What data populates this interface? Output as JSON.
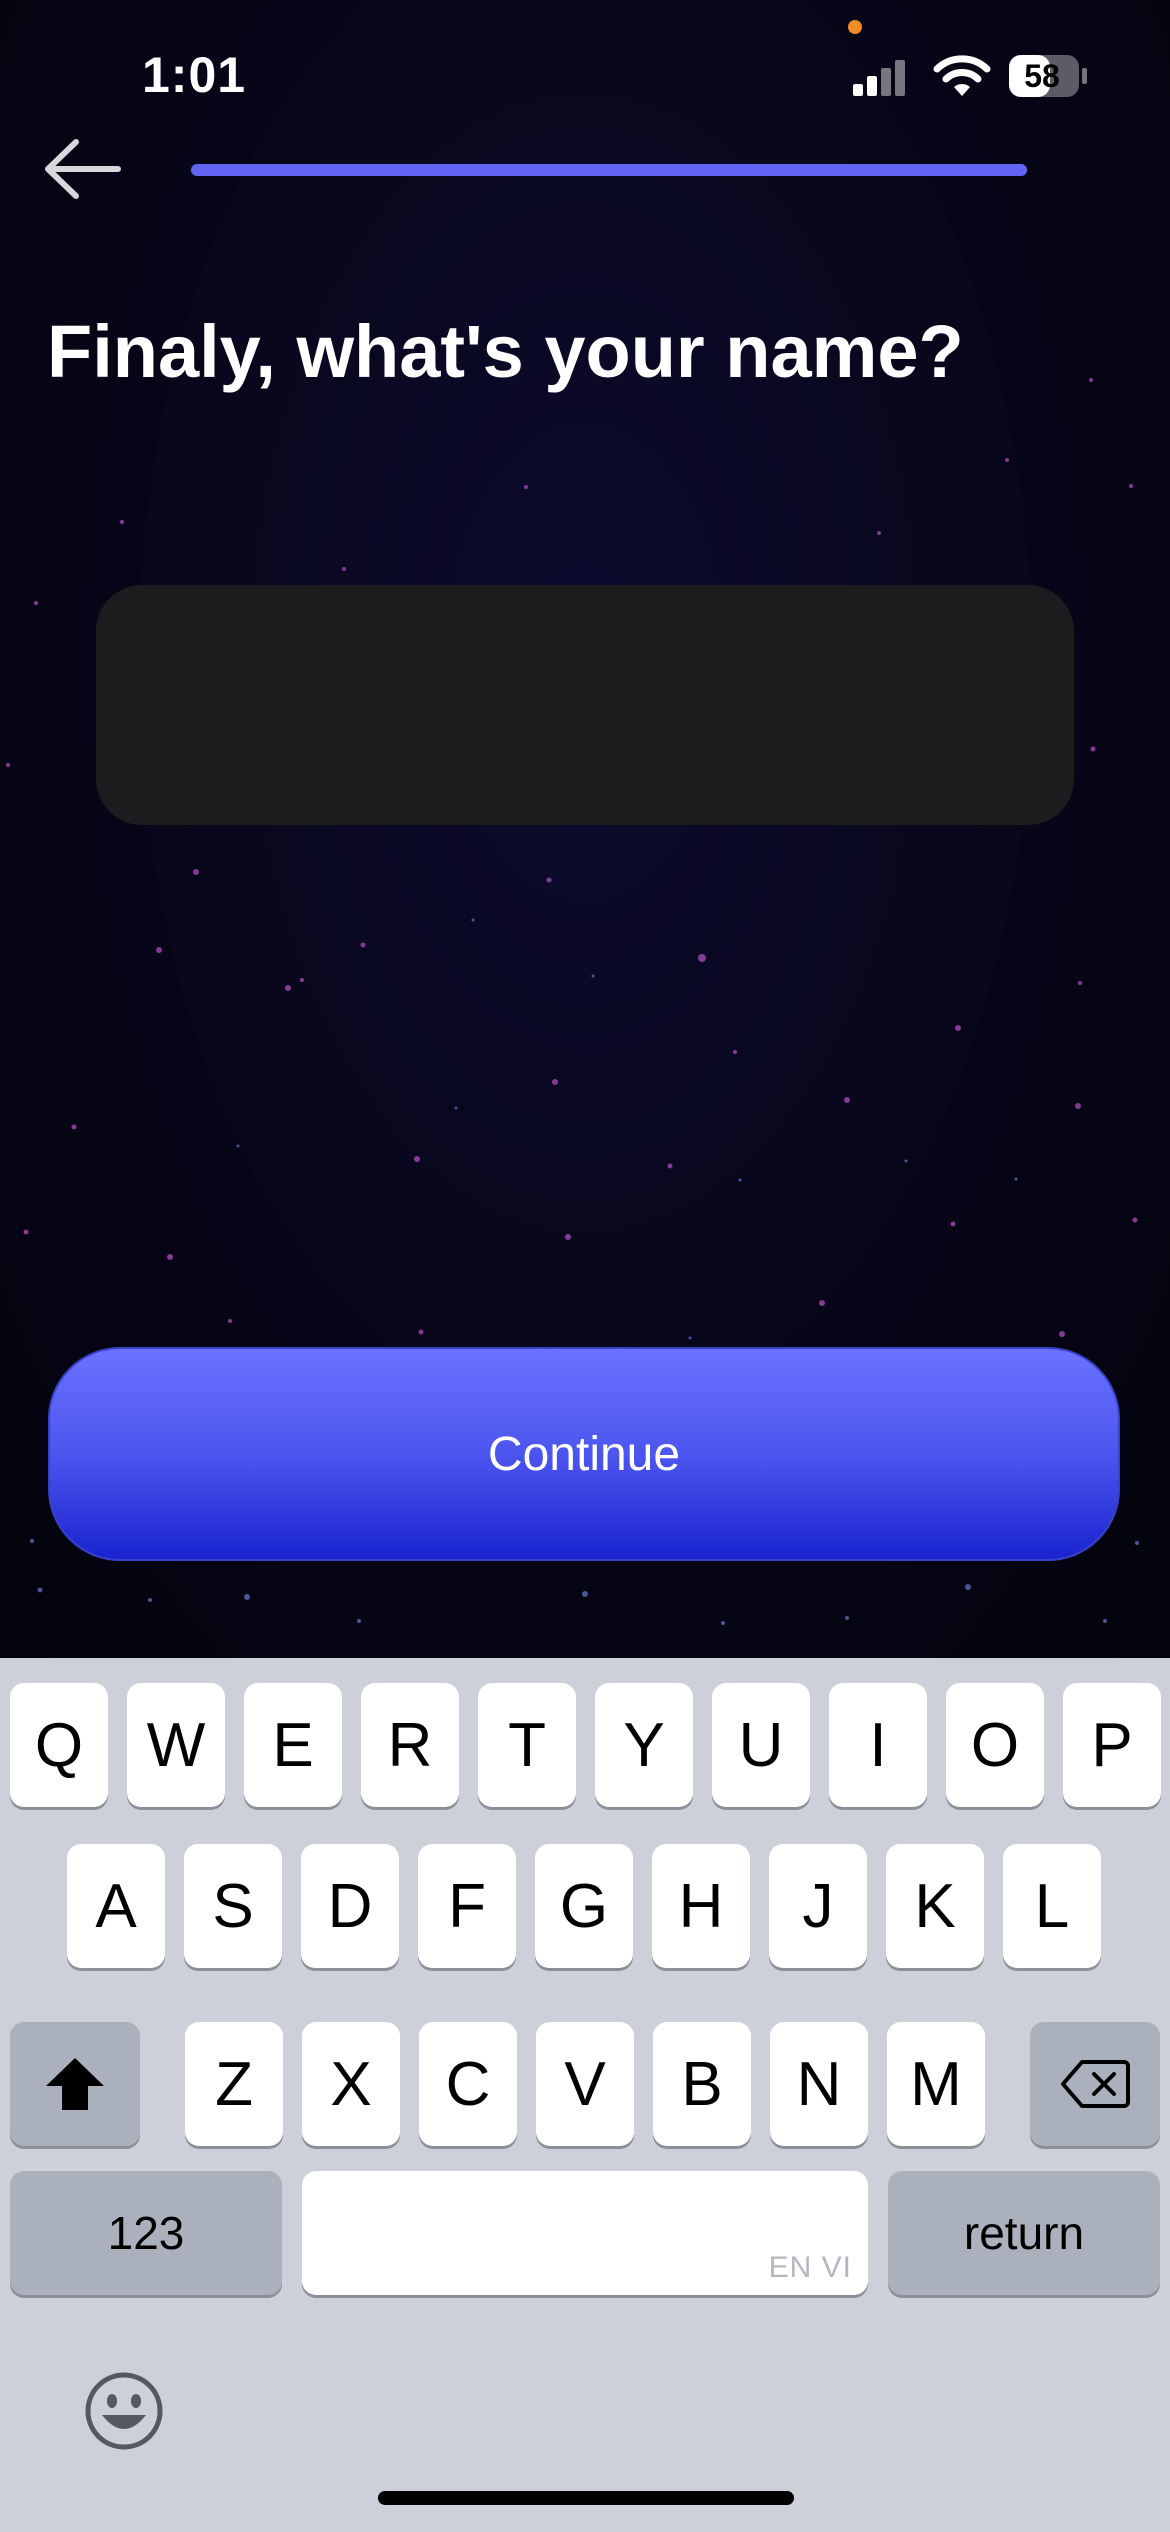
{
  "status_bar": {
    "time": "1:01",
    "battery": "58",
    "icons": [
      "cellular-signal-icon",
      "wifi-icon",
      "battery-icon"
    ]
  },
  "header": {
    "back_icon": "arrow-left-icon",
    "progress_fraction": 1.0
  },
  "main": {
    "title": "Finaly, what's your name?",
    "name_input": {
      "value": "",
      "placeholder": ""
    },
    "continue_label": "Continue"
  },
  "keyboard": {
    "row1": [
      "Q",
      "W",
      "E",
      "R",
      "T",
      "Y",
      "U",
      "I",
      "O",
      "P"
    ],
    "row2": [
      "A",
      "S",
      "D",
      "F",
      "G",
      "H",
      "J",
      "K",
      "L"
    ],
    "row3": [
      "Z",
      "X",
      "C",
      "V",
      "B",
      "N",
      "M"
    ],
    "shift_icon": "shift-arrow-icon",
    "delete_icon": "backspace-icon",
    "numbers_label": "123",
    "space_hint": "EN VI",
    "return_label": "return",
    "emoji_icon": "emoji-smiley-icon"
  },
  "colors": {
    "accent": "#6265f4",
    "button_top": "#6b72ff",
    "button_bottom": "#1a24cf",
    "background": "#070617",
    "input_bg": "#1c1c1e",
    "keyboard_bg": "#cdd0d9"
  }
}
